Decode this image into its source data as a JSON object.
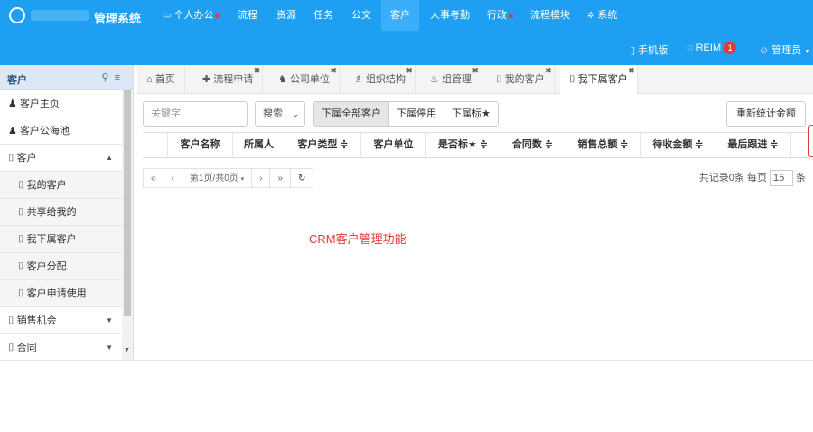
{
  "app": {
    "title": "管理系统"
  },
  "topnav": [
    {
      "label": "个人办公",
      "icon": "monitor-icon",
      "dot": true
    },
    {
      "label": "流程"
    },
    {
      "label": "资源"
    },
    {
      "label": "任务"
    },
    {
      "label": "公文"
    },
    {
      "label": "客户",
      "active": true
    },
    {
      "label": "人事考勤"
    },
    {
      "label": "行政",
      "dot": true
    },
    {
      "label": "流程模块"
    },
    {
      "label": "系统",
      "icon": "gear-icon"
    }
  ],
  "topbar2": {
    "mobile": "手机版",
    "reim": "REIM",
    "reim_badge": "1",
    "user": "管理员"
  },
  "sidebar": {
    "title": "客户",
    "items": [
      {
        "label": "客户主页",
        "icon": "user-icon",
        "type": "item"
      },
      {
        "label": "客户公海池",
        "icon": "user-icon",
        "type": "item"
      },
      {
        "label": "客户",
        "icon": "bookmark-icon",
        "type": "group",
        "expanded": true
      },
      {
        "label": "我的客户",
        "icon": "bookmark-icon",
        "type": "sub"
      },
      {
        "label": "共享给我的",
        "icon": "bookmark-icon",
        "type": "sub"
      },
      {
        "label": "我下属客户",
        "icon": "bookmark-icon",
        "type": "sub"
      },
      {
        "label": "客户分配",
        "icon": "bookmark-icon",
        "type": "sub"
      },
      {
        "label": "客户申请使用",
        "icon": "bookmark-icon",
        "type": "sub"
      },
      {
        "label": "销售机会",
        "icon": "bookmark-icon",
        "type": "group"
      },
      {
        "label": "合同",
        "icon": "bookmark-icon",
        "type": "group"
      }
    ]
  },
  "tabs": [
    {
      "label": "首页",
      "icon": "home-icon"
    },
    {
      "label": "流程申请",
      "icon": "plus-icon",
      "closable": true
    },
    {
      "label": "公司单位",
      "icon": "group-icon",
      "closable": true
    },
    {
      "label": "组织结构",
      "icon": "sitemap-icon",
      "closable": true
    },
    {
      "label": "组管理",
      "icon": "users-icon",
      "closable": true
    },
    {
      "label": "我的客户",
      "icon": "bookmark-icon",
      "closable": true
    },
    {
      "label": "我下属客户",
      "icon": "bookmark-icon",
      "closable": true,
      "active": true
    }
  ],
  "toolbar": {
    "search_placeholder": "关键字",
    "search_label": "搜索",
    "filters": [
      "下属全部客户",
      "下属停用",
      "下属标★"
    ],
    "export_label": "重新统计金额"
  },
  "table": {
    "columns": [
      "",
      "客户名称",
      "所属人",
      "客户类型 ≑",
      "客户单位",
      "是否标★ ≑",
      "合同数 ≑",
      "销售总额 ≑",
      "待收金额 ≑",
      "最后跟进 ≑",
      ""
    ]
  },
  "pager": {
    "first": "«",
    "prev": "‹",
    "page": "第1页/共0页",
    "next": "›",
    "last": "»",
    "info_prefix": "共记录0条  每页",
    "page_size": "15",
    "info_suffix": "条"
  },
  "overlay": {
    "crm_label": "CRM客户管理功能"
  }
}
